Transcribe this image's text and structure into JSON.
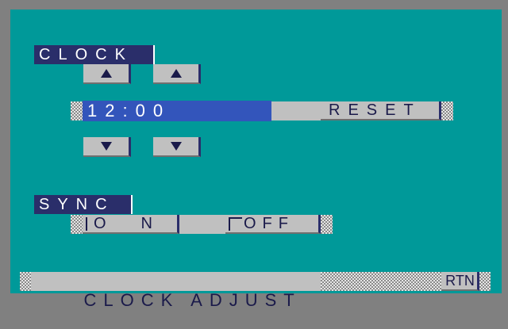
{
  "clock": {
    "title": "CLOCK",
    "time_value": "12:00",
    "reset_label": "RESET",
    "up_icon": "triangle-up-icon",
    "down_icon": "triangle-down-icon"
  },
  "sync": {
    "title": "SYNC",
    "on_label": "ON",
    "off_label": "OFF",
    "selected": "ON"
  },
  "footer": {
    "title": "CLOCK ADJUST",
    "return_label": "RTN"
  },
  "colors": {
    "background": "#009999",
    "frame": "#808080",
    "title_bg": "#2a2e6a",
    "field_bg": "#3355bb",
    "button_bg": "#c0c0c0",
    "selected_indicator": "#44b3b3"
  }
}
